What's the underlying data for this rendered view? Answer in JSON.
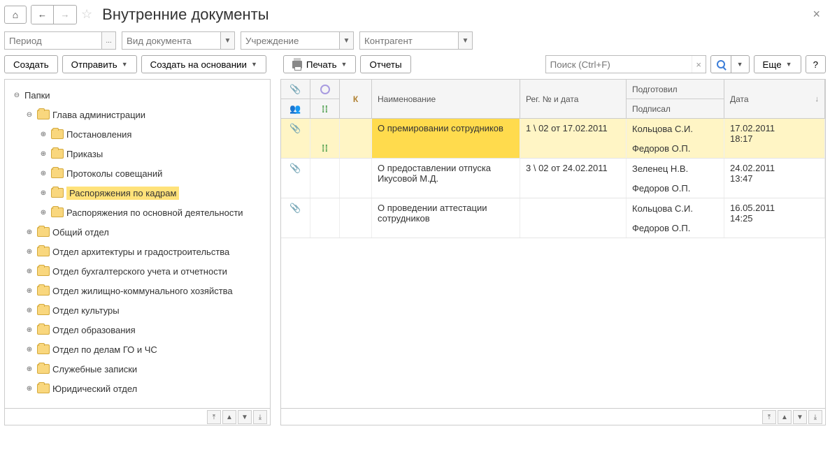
{
  "header": {
    "title": "Внутренние документы"
  },
  "filters": {
    "period": {
      "placeholder": "Период",
      "ellipsis": "..."
    },
    "docType": {
      "placeholder": "Вид документа"
    },
    "org": {
      "placeholder": "Учреждение"
    },
    "contractor": {
      "placeholder": "Контрагент"
    }
  },
  "toolbar": {
    "create": "Создать",
    "send": "Отправить",
    "createBased": "Создать на основании",
    "print": "Печать",
    "reports": "Отчеты",
    "searchPlaceholder": "Поиск (Ctrl+F)",
    "more": "Еще",
    "help": "?"
  },
  "tree": {
    "root": "Папки",
    "items": [
      {
        "label": "Глава администрации",
        "level": 1,
        "expanded": true,
        "children": [
          {
            "label": "Постановления",
            "level": 2
          },
          {
            "label": "Приказы",
            "level": 2
          },
          {
            "label": "Протоколы совещаний",
            "level": 2
          },
          {
            "label": "Распоряжения по кадрам",
            "level": 2,
            "selected": true
          },
          {
            "label": "Распоряжения по основной деятельности",
            "level": 2
          }
        ]
      },
      {
        "label": "Общий отдел",
        "level": 1
      },
      {
        "label": "Отдел архитектуры и градостроительства",
        "level": 1
      },
      {
        "label": "Отдел бухгалтерского учета и отчетности",
        "level": 1
      },
      {
        "label": "Отдел жилищно-коммунального хозяйства",
        "level": 1
      },
      {
        "label": "Отдел культуры",
        "level": 1
      },
      {
        "label": "Отдел образования",
        "level": 1
      },
      {
        "label": "Отдел по делам ГО и ЧС",
        "level": 1
      },
      {
        "label": "Служебные записки",
        "level": 1
      },
      {
        "label": "Юридический отдел",
        "level": 1
      }
    ]
  },
  "table": {
    "headers": {
      "k": "К",
      "name": "Наименование",
      "reg": "Рег. № и дата",
      "prepared": "Подготовил",
      "signed": "Подписал",
      "date": "Дата"
    },
    "rows": [
      {
        "selected": true,
        "hasClip": true,
        "hasDots": true,
        "name": "О премировании сотрудников",
        "reg": "1 \\ 02 от 17.02.2011",
        "prepared": "Кольцова С.И.",
        "signed": "Федоров О.П.",
        "date": "17.02.2011 18:17"
      },
      {
        "hasClip": true,
        "name": "О предоставлении отпуска Икусовой М.Д.",
        "reg": "3 \\ 02 от 24.02.2011",
        "prepared": "Зеленец Н.В.",
        "signed": "Федоров О.П.",
        "date": "24.02.2011 13:47"
      },
      {
        "hasClip": true,
        "name": "О проведении аттестации сотрудников",
        "reg": "",
        "prepared": "Кольцова С.И.",
        "signed": "Федоров О.П.",
        "date": "16.05.2011 14:25"
      }
    ]
  }
}
